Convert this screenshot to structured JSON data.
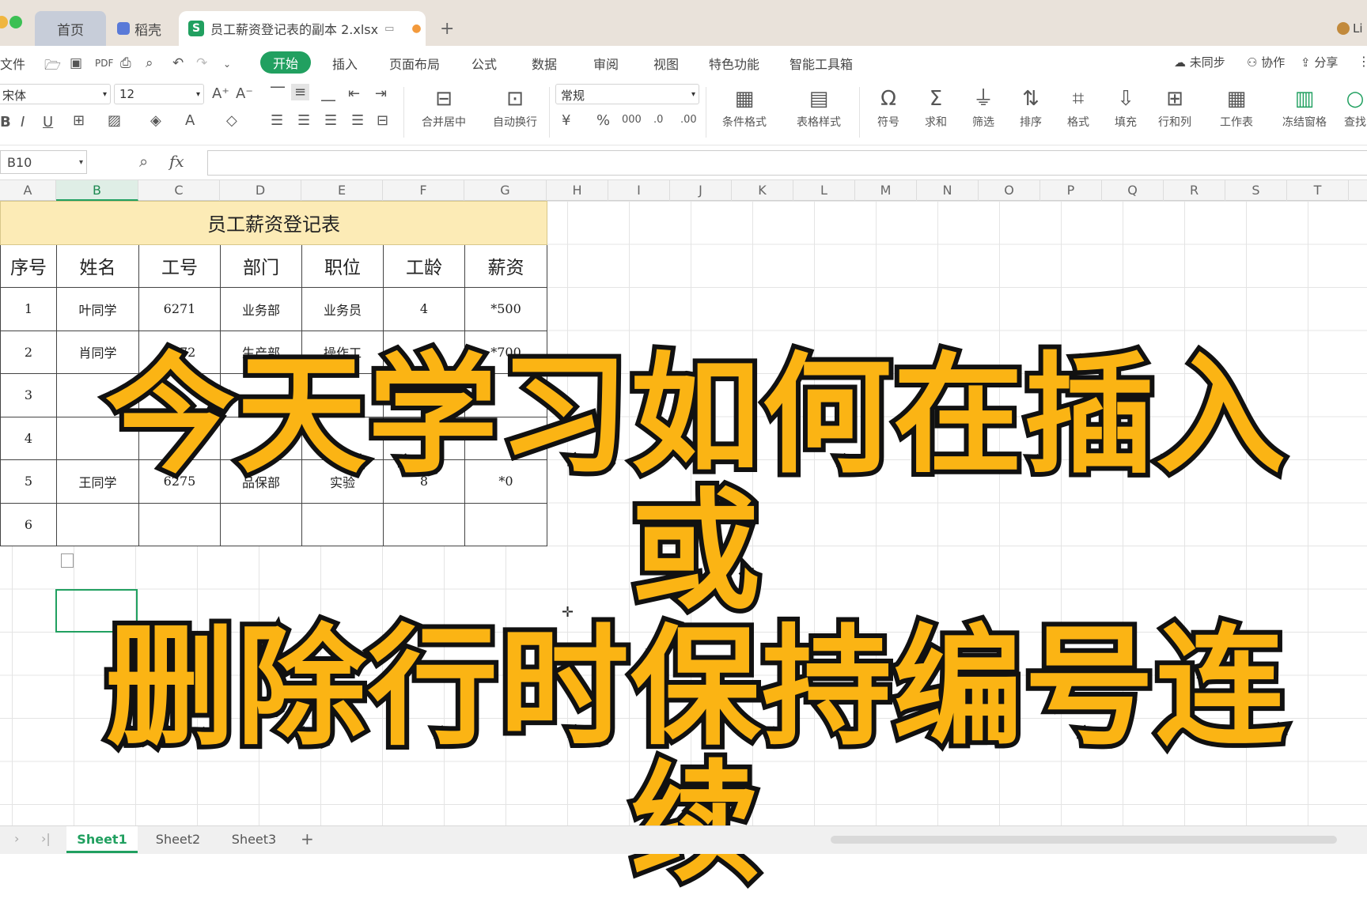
{
  "tabs": {
    "home": "首页",
    "docer": "稻壳",
    "file": "员工薪资登记表的副本 2.xlsx",
    "user": "Li"
  },
  "menu": {
    "file": "文件",
    "items": [
      "开始",
      "插入",
      "页面布局",
      "公式",
      "数据",
      "审阅",
      "视图",
      "特色功能",
      "智能工具箱"
    ],
    "sync": "未同步",
    "collab": "协作",
    "share": "分享"
  },
  "ribbon": {
    "font_name": "宋体",
    "font_size": "12",
    "number_format": "常规",
    "merge": "合并居中",
    "wrap": "自动换行",
    "cond_format": "条件格式",
    "table_style": "表格样式",
    "symbol": "符号",
    "sum": "求和",
    "filter": "筛选",
    "sort": "排序",
    "format": "格式",
    "fill": "填充",
    "rowcol": "行和列",
    "worksheet": "工作表",
    "freeze": "冻结窗格",
    "find": "查找"
  },
  "formula": {
    "namebox": "B10",
    "fx": "fx"
  },
  "columns": [
    "A",
    "B",
    "C",
    "D",
    "E",
    "F",
    "G",
    "H",
    "I",
    "J",
    "K",
    "L",
    "M",
    "N",
    "O",
    "P",
    "Q",
    "R",
    "S",
    "T"
  ],
  "table": {
    "title": "员工薪资登记表",
    "headers": [
      "序号",
      "姓名",
      "工号",
      "部门",
      "职位",
      "工龄",
      "薪资"
    ],
    "rows": [
      [
        "1",
        "叶同学",
        "6271",
        "业务部",
        "业务员",
        "4",
        "*500"
      ],
      [
        "2",
        "肖同学",
        "6272",
        "生产部",
        "操作工",
        "6",
        "*700"
      ],
      [
        "3",
        "",
        "",
        "",
        "",
        "",
        ""
      ],
      [
        "4",
        "",
        "",
        "",
        "",
        "",
        ""
      ],
      [
        "5",
        "王同学",
        "6275",
        "品保部",
        "实验",
        "8",
        "*0"
      ],
      [
        "6",
        "",
        "",
        "",
        "",
        "",
        ""
      ]
    ]
  },
  "caption": {
    "line1": "今天学习如何在插入或",
    "line2": "删除行时保持编号连续"
  },
  "sheets": [
    "Sheet1",
    "Sheet2",
    "Sheet3"
  ],
  "colors": {
    "accent": "#21a060",
    "title_fill": "#fcebb6",
    "caption": "#fbb414"
  }
}
